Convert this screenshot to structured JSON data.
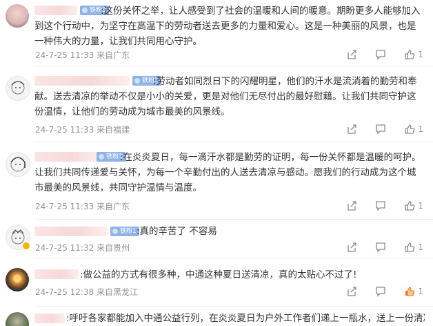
{
  "comments": [
    {
      "badge": "铁粉3",
      "text": ":这份关怀之举，让人感受到了社会的温暖和人间的暖意。期盼更多人能够加入到这个行动中，为坚守在高温下的劳动者送去更多的力量和爱心。这是一种美丽的风景，也是一种伟大的力量，让我们共同用心守护。",
      "time": "24-7-25 11:33",
      "location": "来自广东",
      "likes": "1"
    },
    {
      "badge": "铁粉3",
      "text": ":劳动者如同烈日下的闪耀明星，他们的汗水是流淌着的勤劳和奉献。送去清凉的举动不仅是小小的关爱，更是对他们无尽付出的最好慰藉。让我们共同守护这份温情，让他们的劳动成为城市最美的风景线。",
      "time": "24-7-25 11:33",
      "location": "来自福建",
      "likes": "1"
    },
    {
      "badge": "铁粉3",
      "text": ":在炎炎夏日，每一滴汗水都是勤劳的证明，每一份关怀都是温暖的呵护。让我们共同传递爱与关怀，为每一个辛勤付出的人送去清凉与感动。愿我们的行动成为这个城市最美的风景线，共同守护温情与温度。",
      "time": "24-7-25 11:33",
      "location": "来自广东",
      "likes": "1"
    },
    {
      "badge": "铁粉1",
      "text": ":真的辛苦了  不容易",
      "time": "24-7-25 11:32",
      "location": "来自贵州",
      "likes": "1"
    },
    {
      "badge": "",
      "text": ":做公益的方式有很多种，中通这种夏日送清凉，真的太贴心不过了!",
      "time": "24-7-25 12:38",
      "location": "来自黑龙江",
      "likes": "1"
    },
    {
      "badge": "",
      "text": ":呼吁各家都能加入中通公益行列，在炎炎夏日为户外工作者们递上一瓶水，送上一份清凉",
      "time": "",
      "location": "",
      "likes": ""
    }
  ],
  "icons": [
    "share-icon",
    "comment-icon",
    "like-icon"
  ],
  "colors": {
    "meta": "#939393",
    "liked": "#f07b1d",
    "badge": "#8fb3e8"
  }
}
